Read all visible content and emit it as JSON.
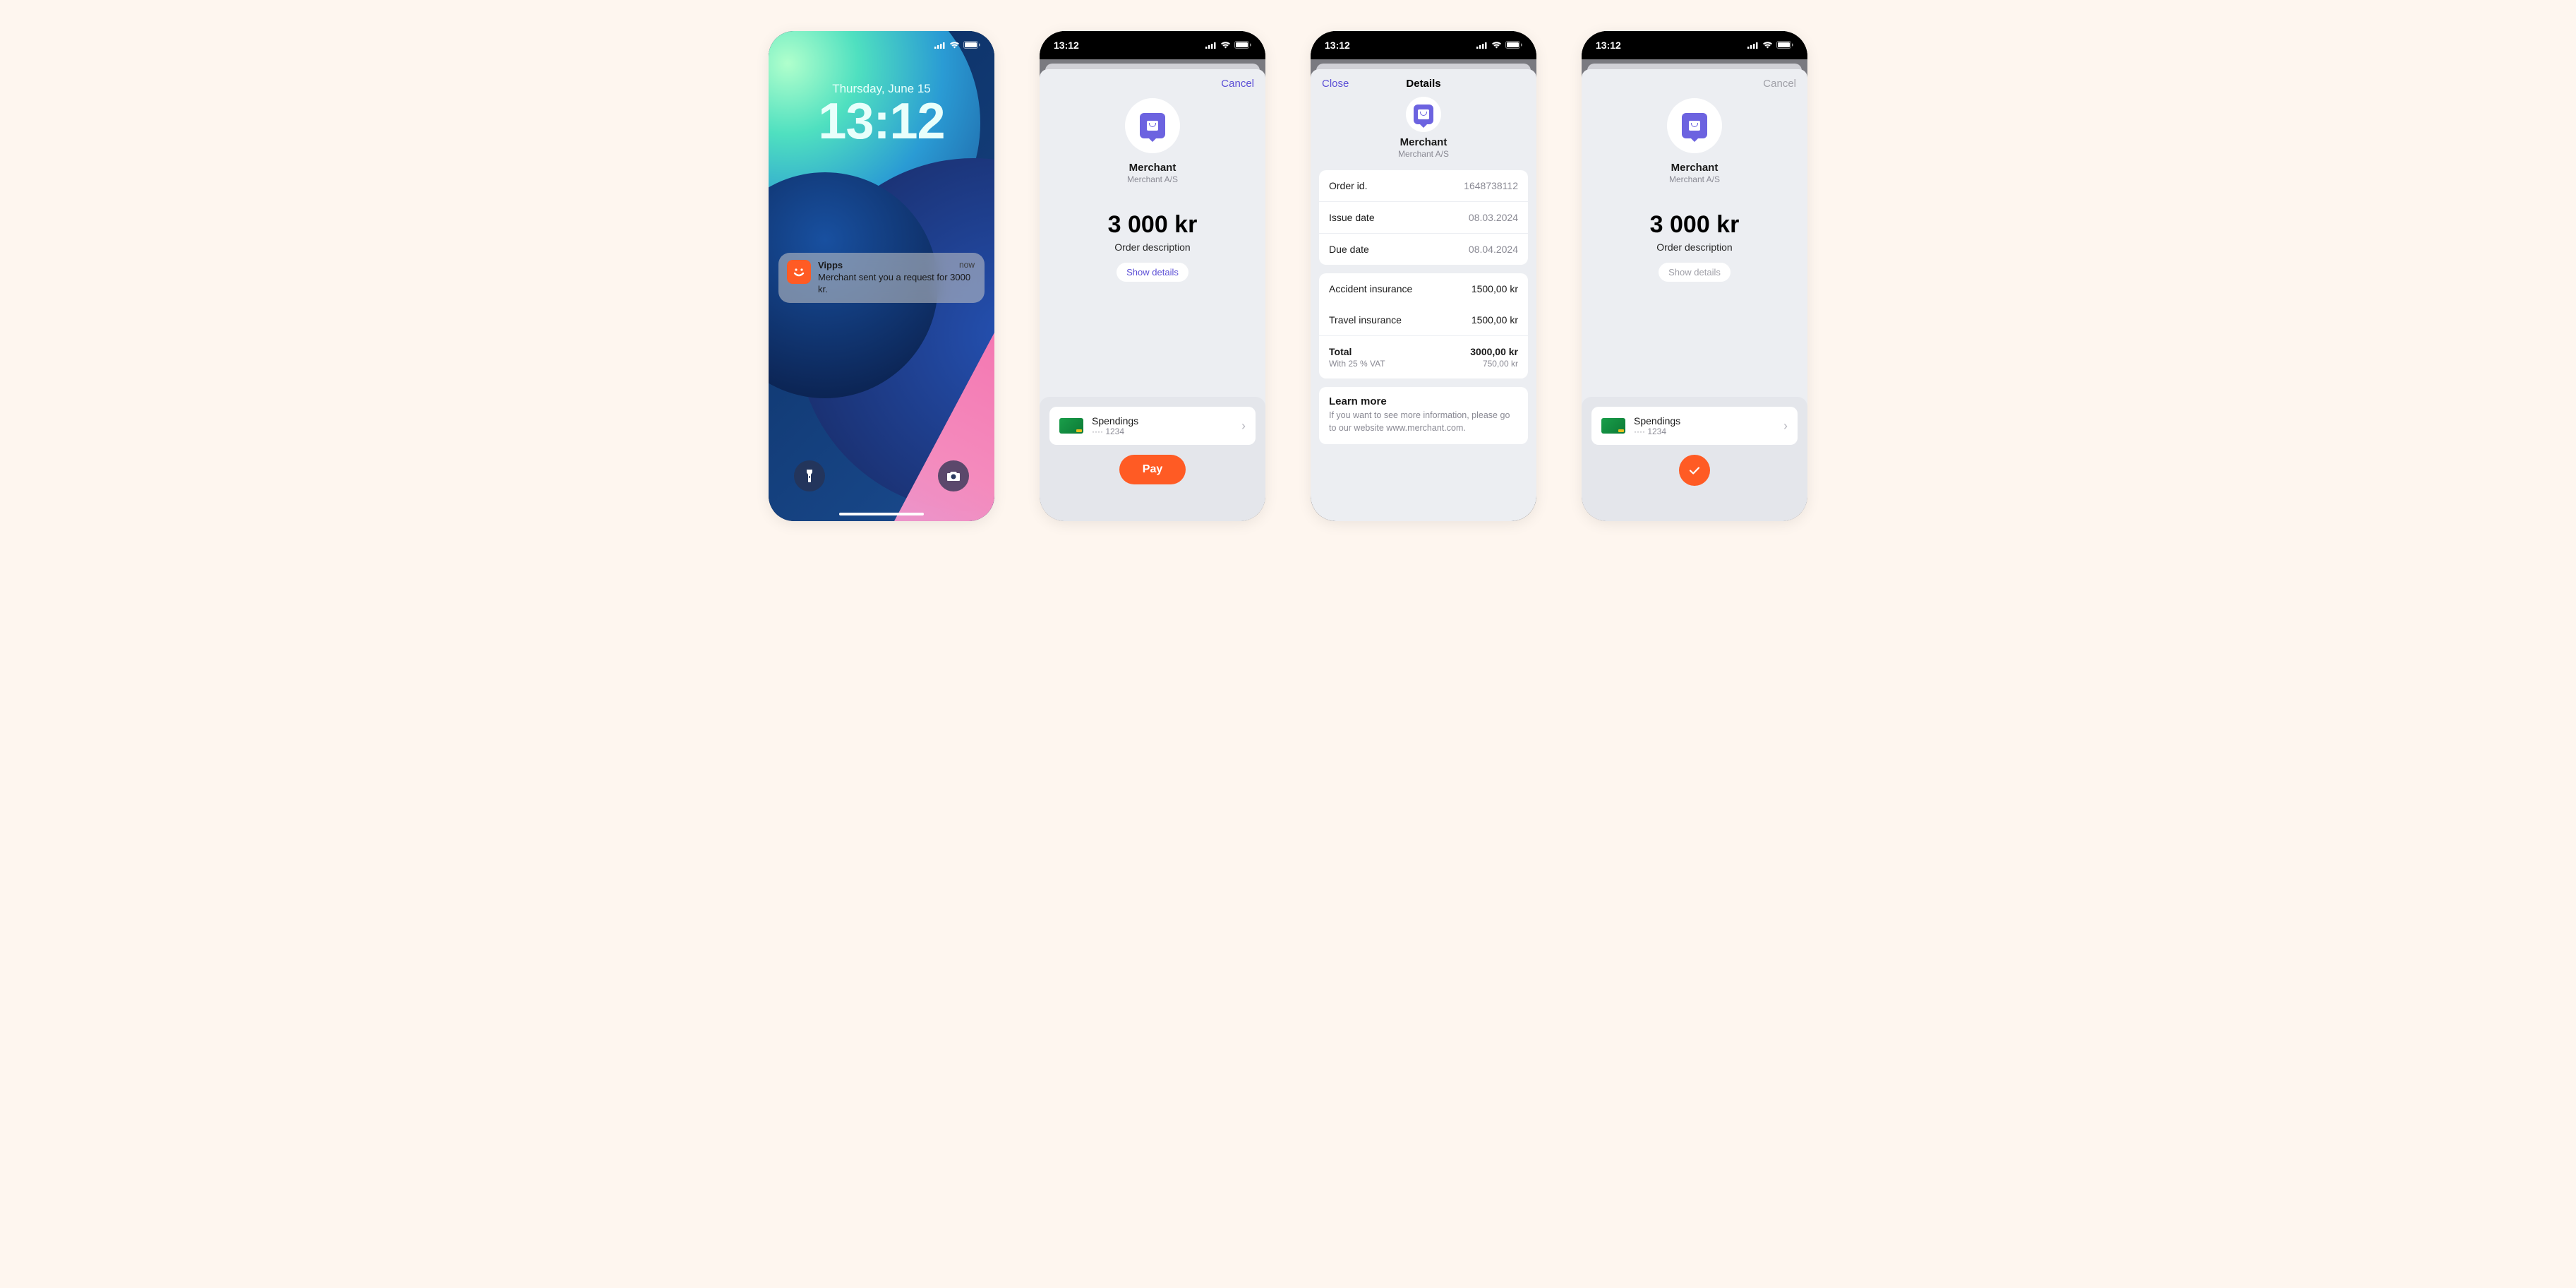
{
  "status_time": "13:12",
  "lockscreen": {
    "date": "Thursday, June 15",
    "time": "13:12",
    "notification": {
      "app": "Vipps",
      "body": "Merchant sent you a request for 3000 kr.",
      "time_label": "now"
    }
  },
  "merchant": {
    "name": "Merchant",
    "legal_name": "Merchant A/S"
  },
  "payment": {
    "amount": "3 000 kr",
    "description": "Order description",
    "show_details_label": "Show details",
    "cancel_label": "Cancel",
    "pay_label": "Pay"
  },
  "card": {
    "name": "Spendings",
    "digits": "···· 1234"
  },
  "details": {
    "close_label": "Close",
    "title": "Details",
    "meta_rows": [
      {
        "label": "Order id.",
        "value": "1648738112"
      },
      {
        "label": "Issue date",
        "value": "08.03.2024"
      },
      {
        "label": "Due date",
        "value": "08.04.2024"
      }
    ],
    "line_items": [
      {
        "label": "Accident insurance",
        "value": "1500,00 kr"
      },
      {
        "label": "Travel insurance",
        "value": "1500,00 kr"
      }
    ],
    "total": {
      "label": "Total",
      "value": "3000,00 kr",
      "vat_label": "With 25 % VAT",
      "vat_value": "750,00 kr"
    },
    "learn_more": {
      "title": "Learn more",
      "text": "If you want to see more information, please go to our website www.merchant.com."
    }
  }
}
